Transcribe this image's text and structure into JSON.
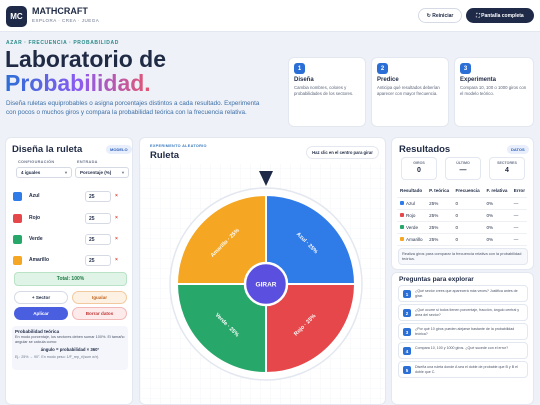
{
  "header": {
    "logo": "MC",
    "brand": "MATHCRAFT",
    "tagline": "EXPLORA · CREA · JUEGA",
    "reset_label": "↻ Reiniciar",
    "fullscreen_label": "⛶ Pantalla completa"
  },
  "hero": {
    "tag": "AZAR · FRECUENCIA · PROBABILIDAD",
    "title_line1": "Laboratorio de",
    "title_line2": "Probabilidad.",
    "description": "Diseña ruletas equiprobables o asigna porcentajes distintos a cada resultado. Experimenta con pocos o muchos giros y compara la probabilidad teórica con la frecuencia relativa."
  },
  "steps": [
    {
      "num": "1",
      "title": "Diseña",
      "desc": "Cambia nombres, colores y probabilidades de los sectores."
    },
    {
      "num": "2",
      "title": "Predice",
      "desc": "Anticipa qué resultados deberían aparecer con mayor frecuencia."
    },
    {
      "num": "3",
      "title": "Experimenta",
      "desc": "Compara 10, 100 o 1000 giros con el modelo teórico."
    }
  ],
  "design": {
    "title": "Diseña la ruleta",
    "badge": "MODELO",
    "config_label": "CONFIGURACIÓN",
    "config_value": "4 iguales",
    "input_label": "ENTRADA",
    "input_value": "Porcentaje (%)",
    "sectors": [
      {
        "name": "Azul",
        "value": "25",
        "color": "#2f7be8"
      },
      {
        "name": "Rojo",
        "value": "25",
        "color": "#e6474a"
      },
      {
        "name": "Verde",
        "value": "25",
        "color": "#27a86a"
      },
      {
        "name": "Amarillo",
        "value": "25",
        "color": "#f5a623"
      }
    ],
    "remove_symbol": "×",
    "total": "Total: 100%",
    "add_label": "+ Sector",
    "equal_label": "Igualar",
    "apply_label": "Aplicar",
    "clear_label": "Borrar datos",
    "theory_title": "Probabilidad teórica",
    "theory_text": "En modo porcentaje, los sectores deben sumar 100%. El tamaño angular se calcula como:",
    "formula": "ángulo = probabilidad × 360°",
    "example": "Ej.: 25% → 90°. En modo peso: 1/F_rep_r/(sum w/r)."
  },
  "wheel": {
    "kicker": "EXPERIMENTO ALEATORIO",
    "title": "Ruleta",
    "hint": "Haz clic en el centro para girar",
    "spin_label": "GIRAR",
    "labels": [
      "Azul · 25%",
      "Rojo · 25%",
      "Verde · 25%",
      "Amarillo · 25%"
    ]
  },
  "results": {
    "title": "Resultados",
    "badge": "DATOS",
    "stats": [
      {
        "label": "GIROS",
        "value": "0"
      },
      {
        "label": "ÚLTIMO",
        "value": "—"
      },
      {
        "label": "SECTORES",
        "value": "4"
      }
    ],
    "headers": [
      "Resultado",
      "P. teórica",
      "Frecuencia",
      "F. relativa",
      "Error"
    ],
    "rows": [
      {
        "name": "Azul",
        "p": "25%",
        "f": "0",
        "fr": "0%",
        "e": "—",
        "color": "#2f7be8"
      },
      {
        "name": "Rojo",
        "p": "25%",
        "f": "0",
        "fr": "0%",
        "e": "—",
        "color": "#e6474a"
      },
      {
        "name": "Verde",
        "p": "25%",
        "f": "0",
        "fr": "0%",
        "e": "—",
        "color": "#27a86a"
      },
      {
        "name": "Amarillo",
        "p": "25%",
        "f": "0",
        "fr": "0%",
        "e": "—",
        "color": "#f5a623"
      }
    ],
    "note": "Realiza giros para comparar la frecuencia relativa con la probabilidad teórica."
  },
  "questions": {
    "title": "Preguntas para explorar",
    "items": [
      {
        "num": "1",
        "text": "¿Qué sector crees que aparecerá más veces? Justifica antes de girar."
      },
      {
        "num": "2",
        "text": "¿Qué ocurre si todos tienen porcentaje, fracción, ángulo central y área del sector?"
      },
      {
        "num": "3",
        "text": "¿Por qué 10 giros pueden alejarse bastante de la probabilidad teórica?"
      },
      {
        "num": "4",
        "text": "Compara 10, 100 y 1000 giros. ¿Qué sucede con el error?"
      },
      {
        "num": "5",
        "text": "Diseña una ruleta donde A sea el doble de probable que B y B el doble que C."
      }
    ]
  }
}
